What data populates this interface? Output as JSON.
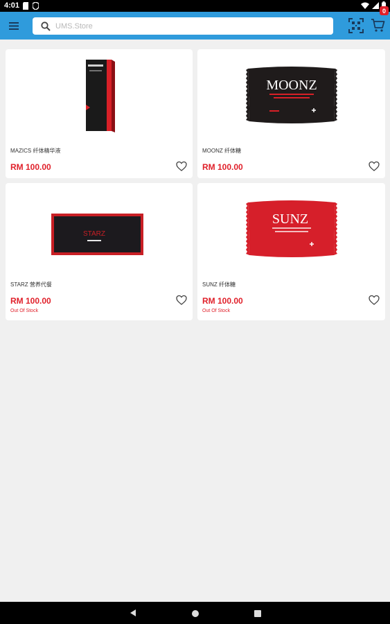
{
  "status_bar": {
    "time": "4:01",
    "icons": [
      "sd-card-icon",
      "shield-icon",
      "wifi-icon",
      "signal-icon",
      "battery-icon"
    ]
  },
  "app_bar": {
    "menu_icon": "hamburger-menu-icon",
    "search": {
      "placeholder": "UMS.Store",
      "value": ""
    },
    "qr_icon": "qr-scan-icon",
    "cart_icon": "shopping-cart-icon",
    "cart_count": "0",
    "colors": {
      "bar": "#2f9bdc",
      "badge": "#e0202a"
    }
  },
  "products": [
    {
      "name": "MAZICS 纤体精华液",
      "price": "RM 100.00",
      "stock": "",
      "image_label": "MAZICS",
      "image_type": "tall-box"
    },
    {
      "name": "MOONZ 纤体糖",
      "price": "RM 100.00",
      "stock": "",
      "image_label": "MOONZ",
      "image_type": "sachet-black"
    },
    {
      "name": "STARZ 营养代餐",
      "price": "RM 100.00",
      "stock": "Out Of Stock",
      "image_label": "STARZ",
      "image_type": "flat-box"
    },
    {
      "name": "SUNZ 纤体糖",
      "price": "RM 100.00",
      "stock": "Out Of Stock",
      "image_label": "SUNZ",
      "image_type": "sachet-red"
    }
  ],
  "colors": {
    "price": "#e0202a",
    "background": "#f0f0f0"
  },
  "nav_bar": {
    "icons": [
      "back-icon",
      "home-icon",
      "recents-icon"
    ]
  }
}
